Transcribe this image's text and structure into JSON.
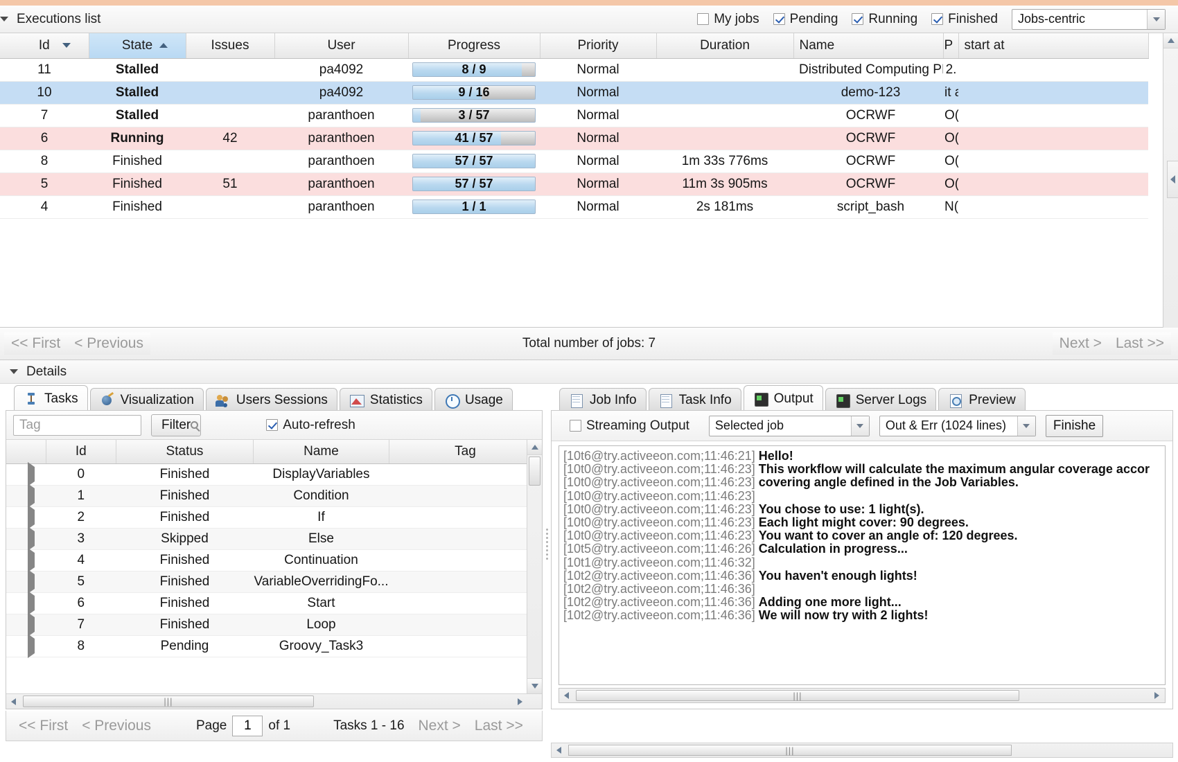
{
  "top": {
    "executions_title": "Executions list",
    "filters": [
      {
        "label": "My jobs",
        "checked": false
      },
      {
        "label": "Pending",
        "checked": true
      },
      {
        "label": "Running",
        "checked": true
      },
      {
        "label": "Finished",
        "checked": true
      }
    ],
    "view_select": {
      "value": "Jobs-centric"
    }
  },
  "jobs_grid": {
    "columns": [
      "Id",
      "State",
      "Issues",
      "User",
      "Progress",
      "Priority",
      "Duration",
      "Name",
      "P",
      "start at"
    ],
    "sort": {
      "id_dir": "desc",
      "state_dir": "asc"
    },
    "rows": [
      {
        "id": "11",
        "state": "Stalled",
        "issues": "",
        "user": "pa4092",
        "progress_text": "8 / 9",
        "progress_pct": 89,
        "priority": "Normal",
        "duration": "",
        "name": "Distributed Computing PI",
        "p": "2.",
        "row_style": "r-white"
      },
      {
        "id": "10",
        "state": "Stalled",
        "issues": "",
        "user": "pa4092",
        "progress_text": "9 / 16",
        "progress_pct": 56,
        "priority": "Normal",
        "duration": "",
        "name": "demo-123",
        "p": "it a",
        "row_style": "r-sel"
      },
      {
        "id": "7",
        "state": "Stalled",
        "issues": "",
        "user": "paranthoen",
        "progress_text": "3 / 57",
        "progress_pct": 6,
        "priority": "Normal",
        "duration": "",
        "name": "OCRWF",
        "p": "O(",
        "row_style": "r-white"
      },
      {
        "id": "6",
        "state": "Running",
        "issues": "42",
        "user": "paranthoen",
        "progress_text": "41 / 57",
        "progress_pct": 72,
        "priority": "Normal",
        "duration": "",
        "name": "OCRWF",
        "p": "O(",
        "row_style": "r-pink"
      },
      {
        "id": "8",
        "state": "Finished",
        "issues": "",
        "user": "paranthoen",
        "progress_text": "57 / 57",
        "progress_pct": 100,
        "priority": "Normal",
        "duration": "1m 33s 776ms",
        "name": "OCRWF",
        "p": "O(",
        "row_style": "r-white"
      },
      {
        "id": "5",
        "state": "Finished",
        "issues": "51",
        "user": "paranthoen",
        "progress_text": "57 / 57",
        "progress_pct": 100,
        "priority": "Normal",
        "duration": "11m 3s 905ms",
        "name": "OCRWF",
        "p": "O(",
        "row_style": "r-pink"
      },
      {
        "id": "4",
        "state": "Finished",
        "issues": "",
        "user": "paranthoen",
        "progress_text": "1 / 1",
        "progress_pct": 100,
        "priority": "Normal",
        "duration": "2s 181ms",
        "name": "script_bash",
        "p": "N(",
        "row_style": "r-white"
      }
    ]
  },
  "jobs_pager": {
    "first": "<< First",
    "previous": "< Previous",
    "total": "Total number of jobs: 7",
    "next": "Next >",
    "last": "Last >>"
  },
  "details": {
    "title": "Details",
    "left_tabs": [
      {
        "label": "Tasks",
        "icon": "tasks-icon",
        "active": true
      },
      {
        "label": "Visualization",
        "icon": "visualization-icon",
        "active": false
      },
      {
        "label": "Users Sessions",
        "icon": "users-icon",
        "active": false
      },
      {
        "label": "Statistics",
        "icon": "statistics-icon",
        "active": false
      },
      {
        "label": "Usage",
        "icon": "usage-icon",
        "active": false
      }
    ],
    "right_tabs": [
      {
        "label": "Job Info",
        "icon": "job-info-icon",
        "active": false
      },
      {
        "label": "Task Info",
        "icon": "task-info-icon",
        "active": false
      },
      {
        "label": "Output",
        "icon": "output-icon",
        "active": true
      },
      {
        "label": "Server Logs",
        "icon": "server-logs-icon",
        "active": false
      },
      {
        "label": "Preview",
        "icon": "preview-icon",
        "active": false
      }
    ]
  },
  "tasks_panel": {
    "tag_placeholder": "Tag",
    "tag_value": "",
    "filter_button": "Filter",
    "auto_refresh": {
      "label": "Auto-refresh",
      "checked": true
    },
    "columns": [
      "",
      "Id",
      "Status",
      "Name",
      "Tag"
    ],
    "rows": [
      {
        "id": "0",
        "status": "Finished",
        "name": "DisplayVariables",
        "tag": ""
      },
      {
        "id": "1",
        "status": "Finished",
        "name": "Condition",
        "tag": ""
      },
      {
        "id": "2",
        "status": "Finished",
        "name": "If",
        "tag": ""
      },
      {
        "id": "3",
        "status": "Skipped",
        "name": "Else",
        "tag": ""
      },
      {
        "id": "4",
        "status": "Finished",
        "name": "Continuation",
        "tag": ""
      },
      {
        "id": "5",
        "status": "Finished",
        "name": "VariableOverridingFo...",
        "tag": ""
      },
      {
        "id": "6",
        "status": "Finished",
        "name": "Start",
        "tag": ""
      },
      {
        "id": "7",
        "status": "Finished",
        "name": "Loop",
        "tag": ""
      },
      {
        "id": "8",
        "status": "Pending",
        "name": "Groovy_Task3",
        "tag": ""
      }
    ],
    "pager": {
      "first": "<< First",
      "previous": "< Previous",
      "page_label": "Page",
      "page_value": "1",
      "of_label": "of 1",
      "range": "Tasks 1 - 16",
      "next": "Next >",
      "last": "Last >>"
    }
  },
  "output_panel": {
    "streaming": {
      "label": "Streaming Output",
      "checked": false
    },
    "scope_select": {
      "value": "Selected job"
    },
    "lines_select": {
      "value": "Out & Err (1024 lines)"
    },
    "finished_button": "Finishe",
    "log_lines": [
      {
        "stamp": "[10t6@try.activeeon.com;11:46:21]",
        "msg": "Hello!"
      },
      {
        "stamp": "[10t0@try.activeeon.com;11:46:23]",
        "msg": "This workflow will calculate the maximum angular coverage accor"
      },
      {
        "stamp": "[10t0@try.activeeon.com;11:46:23]",
        "msg": "covering angle defined in the Job Variables."
      },
      {
        "stamp": "[10t0@try.activeeon.com;11:46:23]",
        "msg": ""
      },
      {
        "stamp": "[10t0@try.activeeon.com;11:46:23]",
        "msg": "You chose to use: 1 light(s)."
      },
      {
        "stamp": "[10t0@try.activeeon.com;11:46:23]",
        "msg": "Each light might cover: 90 degrees."
      },
      {
        "stamp": "[10t0@try.activeeon.com;11:46:23]",
        "msg": "You want to cover an angle of: 120 degrees."
      },
      {
        "stamp": "[10t5@try.activeeon.com;11:46:26]",
        "msg": "Calculation in progress..."
      },
      {
        "stamp": "[10t1@try.activeeon.com;11:46:32]",
        "msg": ""
      },
      {
        "stamp": "[10t2@try.activeeon.com;11:46:36]",
        "msg": "You haven't enough lights!"
      },
      {
        "stamp": "[10t2@try.activeeon.com;11:46:36]",
        "msg": ""
      },
      {
        "stamp": "[10t2@try.activeeon.com;11:46:36]",
        "msg": "Adding one more light..."
      },
      {
        "stamp": "[10t2@try.activeeon.com;11:46:36]",
        "msg": "We will now try with 2 lights!"
      }
    ]
  },
  "colors": {
    "accent": "#f4c7a8",
    "selected_row": "#c5ddf4",
    "issue_row": "#fbdede",
    "running_text": "#137a26",
    "pending_text": "#2a7fc9"
  }
}
